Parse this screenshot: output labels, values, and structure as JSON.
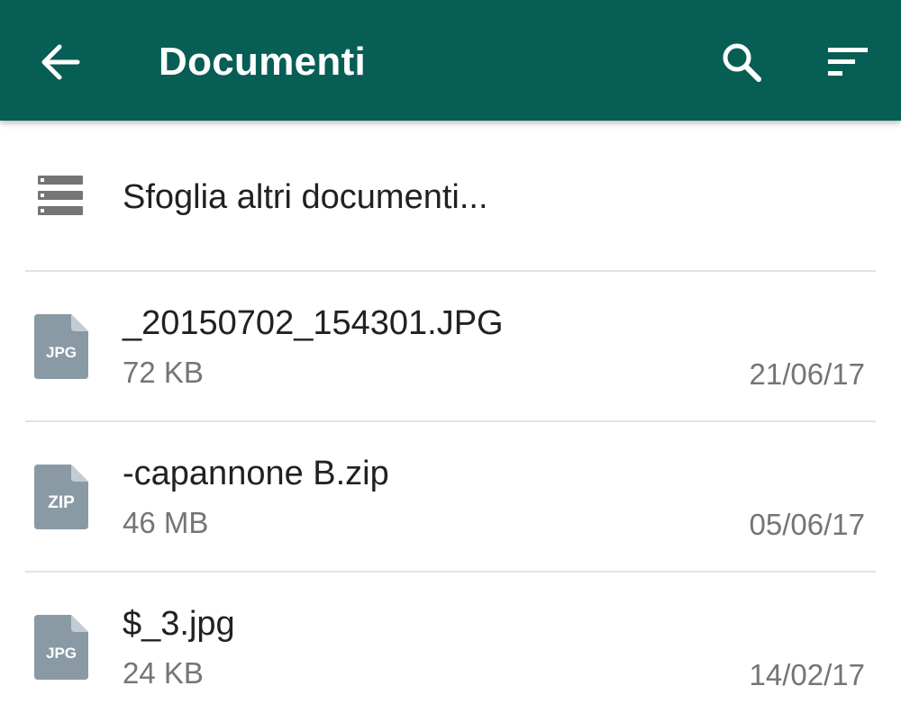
{
  "header": {
    "title": "Documenti",
    "icons": [
      "back-arrow-icon",
      "search-icon",
      "sort-icon"
    ],
    "background_color": "#075e54"
  },
  "browse": {
    "label": "Sfoglia altri documenti...",
    "icon": "storage-list-icon"
  },
  "files": [
    {
      "type": "JPG",
      "name": "_20150702_154301.JPG",
      "size": "72 KB",
      "date": "21/06/17"
    },
    {
      "type": "ZIP",
      "name": "-capannone B.zip",
      "size": "46 MB",
      "date": "05/06/17"
    },
    {
      "type": "JPG",
      "name": "$_3.jpg",
      "size": "24 KB",
      "date": "14/02/17"
    }
  ],
  "colors": {
    "file_icon": "#8a9aa4",
    "primary_text": "#212121",
    "secondary_text": "#757575"
  }
}
